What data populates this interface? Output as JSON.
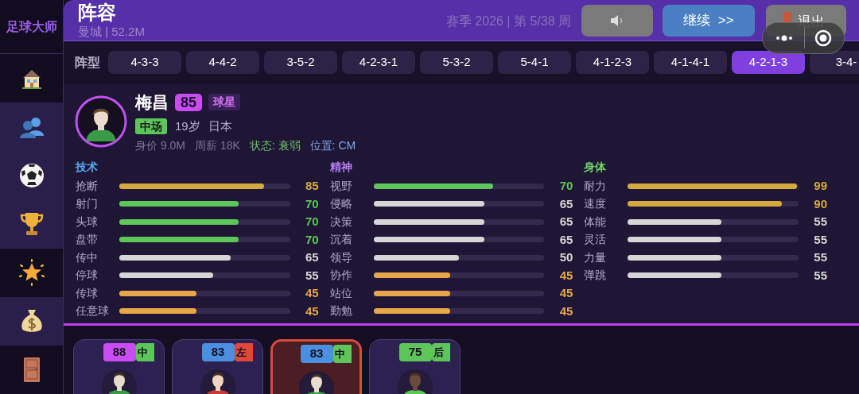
{
  "sidebar": {
    "logo": "足球大师",
    "items": [
      {
        "kind": "home",
        "selected": true
      },
      {
        "kind": "people",
        "selected": false
      },
      {
        "kind": "ball",
        "selected": false
      },
      {
        "kind": "trophy",
        "selected": false
      },
      {
        "kind": "star",
        "selected": true
      },
      {
        "kind": "money",
        "selected": false
      },
      {
        "kind": "door",
        "selected": true
      }
    ]
  },
  "header": {
    "title": "阵容",
    "subtitle": "曼城 | 52.2M",
    "season": "赛季 2026 | 第 5/38 周",
    "buttons": [
      {
        "kind": "sound"
      },
      {
        "kind": "continue",
        "label": "继续  >>"
      },
      {
        "kind": "exit",
        "label": "退出"
      }
    ]
  },
  "formation": {
    "label": "阵型",
    "options": [
      {
        "label": "4-3-3",
        "selected": false
      },
      {
        "label": "4-4-2",
        "selected": false
      },
      {
        "label": "3-5-2",
        "selected": false
      },
      {
        "label": "4-2-3-1",
        "selected": false
      },
      {
        "label": "5-3-2",
        "selected": false
      },
      {
        "label": "5-4-1",
        "selected": false
      },
      {
        "label": "4-1-2-3",
        "selected": false
      },
      {
        "label": "4-1-4-1",
        "selected": false
      },
      {
        "label": "4-2-1-3",
        "selected": true
      },
      {
        "label": "3-4-",
        "selected": false
      }
    ]
  },
  "player": {
    "name": "梅昌",
    "rating": "85",
    "tag": "球星",
    "position": "中场",
    "age": "19岁",
    "nation": "日本",
    "value": "身价 9.0M",
    "wage": "周薪 18K",
    "status": "状态: 衰弱",
    "role": "位置: CM"
  },
  "stat_groups": [
    {
      "title": "技术",
      "color": "#5aa9f0",
      "stats": [
        {
          "name": "抢断",
          "value": "85",
          "level": 0.85,
          "color": "#d4aa3f"
        },
        {
          "name": "射门",
          "value": "70",
          "level": 0.7,
          "color": "#5ec55a"
        },
        {
          "name": "头球",
          "value": "70",
          "level": 0.7,
          "color": "#5ec55a"
        },
        {
          "name": "盘带",
          "value": "70",
          "level": 0.7,
          "color": "#5ec55a"
        },
        {
          "name": "传中",
          "value": "65",
          "level": 0.65,
          "color": "#d6d6d6"
        },
        {
          "name": "停球",
          "value": "55",
          "level": 0.55,
          "color": "#d6d6d6"
        },
        {
          "name": "传球",
          "value": "45",
          "level": 0.45,
          "color": "#e8a64a"
        },
        {
          "name": "任意球",
          "value": "45",
          "level": 0.45,
          "color": "#e8a64a"
        }
      ]
    },
    {
      "title": "精神",
      "color": "#b07cf0",
      "stats": [
        {
          "name": "视野",
          "value": "70",
          "level": 0.7,
          "color": "#5ec55a"
        },
        {
          "name": "侵略",
          "value": "65",
          "level": 0.65,
          "color": "#d6d6d6"
        },
        {
          "name": "决策",
          "value": "65",
          "level": 0.65,
          "color": "#d6d6d6"
        },
        {
          "name": "沉着",
          "value": "65",
          "level": 0.65,
          "color": "#d6d6d6"
        },
        {
          "name": "领导",
          "value": "50",
          "level": 0.5,
          "color": "#d6d6d6"
        },
        {
          "name": "协作",
          "value": "45",
          "level": 0.45,
          "color": "#e8a64a"
        },
        {
          "name": "站位",
          "value": "45",
          "level": 0.45,
          "color": "#e8a64a"
        },
        {
          "name": "勤勉",
          "value": "45",
          "level": 0.45,
          "color": "#e8a64a"
        }
      ]
    },
    {
      "title": "身体",
      "color": "#6fd06a",
      "stats": [
        {
          "name": "耐力",
          "value": "99",
          "level": 0.99,
          "color": "#d4aa3f"
        },
        {
          "name": "速度",
          "value": "90",
          "level": 0.9,
          "color": "#d4aa3f"
        },
        {
          "name": "体能",
          "value": "55",
          "level": 0.55,
          "color": "#d6d6d6"
        },
        {
          "name": "灵活",
          "value": "55",
          "level": 0.55,
          "color": "#d6d6d6"
        },
        {
          "name": "力量",
          "value": "55",
          "level": 0.55,
          "color": "#d6d6d6"
        },
        {
          "name": "弹跳",
          "value": "55",
          "level": 0.55,
          "color": "#d6d6d6"
        }
      ]
    }
  ],
  "squad": [
    {
      "rating": "88",
      "color": "#c84df0",
      "position": {
        "label": "中",
        "color": "#5ec55a"
      },
      "selected": false
    },
    {
      "rating": "83",
      "color": "#4a8fe0",
      "position": {
        "label": "左",
        "color": "#e0483e"
      },
      "selected": false
    },
    {
      "rating": "83",
      "color": "#4a8fe0",
      "position": {
        "label": "中",
        "color": "#5ec55a"
      },
      "selected": true
    },
    {
      "rating": "75",
      "color": "#5ec55a",
      "position": {
        "label": "后",
        "color": "#5ec55a"
      },
      "selected": false
    }
  ]
}
